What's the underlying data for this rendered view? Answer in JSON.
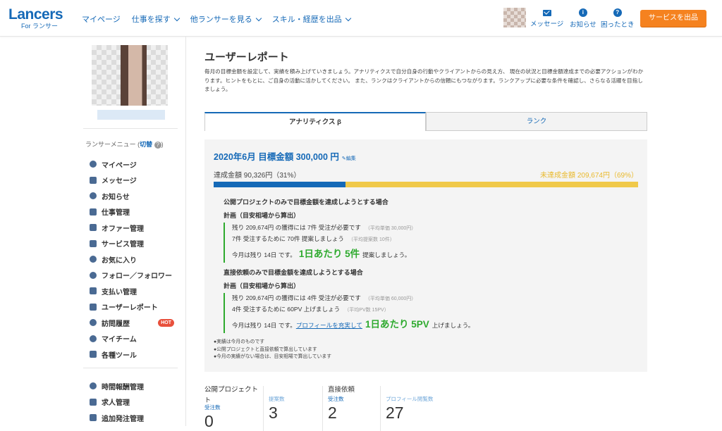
{
  "header": {
    "logo_main": "Lancers",
    "logo_sub": "For ランサー",
    "nav": [
      "マイページ",
      "仕事を探す",
      "他ランサーを見る",
      "スキル・経歴を出品"
    ],
    "messages": "メッセージ",
    "notifications": "お知らせ",
    "help": "困ったとき",
    "service_button": "サービスを出品",
    "accent": "#1569b7",
    "cta_color": "#f5821f"
  },
  "sidebar": {
    "menu_label": "ランサーメニュー (",
    "menu_switch": "切替",
    "menu_end": ")",
    "items": [
      {
        "label": "マイページ",
        "icon": "dashboard-icon"
      },
      {
        "label": "メッセージ",
        "icon": "mail-icon"
      },
      {
        "label": "お知らせ",
        "icon": "info-icon"
      },
      {
        "label": "仕事管理",
        "icon": "briefcase-icon"
      },
      {
        "label": "オファー管理",
        "icon": "briefcase-icon"
      },
      {
        "label": "サービス管理",
        "icon": "cart-icon"
      },
      {
        "label": "お気に入り",
        "icon": "star-icon"
      },
      {
        "label": "フォロー／フォロワー",
        "icon": "user-icon"
      },
      {
        "label": "支払い管理",
        "icon": "card-icon"
      },
      {
        "label": "ユーザーレポート",
        "icon": "chart-icon"
      },
      {
        "label": "訪問履歴",
        "icon": "footprint-icon",
        "badge": "HOT"
      },
      {
        "label": "マイチーム",
        "icon": "team-icon"
      },
      {
        "label": "各種ツール",
        "icon": "wrench-icon"
      }
    ],
    "items2": [
      {
        "label": "時間報酬管理",
        "icon": "clock-icon"
      },
      {
        "label": "求人管理",
        "icon": "building-icon"
      },
      {
        "label": "追加発注管理",
        "icon": "document-icon"
      }
    ]
  },
  "main": {
    "title": "ユーザーレポート",
    "intro": "毎月の目標金額を設定して、実績を積み上げていきましょう。アナリティクスで自分自身の行動やクライアントからの見え方、 現在の状況と目標金額達成までの必要アクションがわかります。ヒントをもとに、ご自身の活動に活かしてください。 また、ランクはクライアントからの信頼にもつながります。ランクアップに必要な条件を確認し、さらなる活躍を目指しましょう。",
    "tabs": [
      "アナリティクス β",
      "ランク"
    ],
    "goal_title": "2020年6月 目標金額  300,000 円",
    "edit": "編集",
    "achieved": "達成金額 90,326円（31%）",
    "remaining": "未達成金額 209,674円（69%）",
    "progress": 0.31,
    "plan1": {
      "heading": "公開プロジェクトのみで目標金額を達成しようとする場合",
      "sub": "計画（目安相場から算出）",
      "line1": "残り 209,674円 の獲得には 7件 受注が必要です",
      "line1_note": "（平均単価 30,000円）",
      "line2": "7件 受注するために 70件 提案しましょう",
      "line2_note": "（平均提案数 10件）",
      "daily_pre": "今月は残り 14日 です。",
      "daily_big": "1日あたり 5件",
      "daily_post": "提案しましょう。"
    },
    "plan2": {
      "heading": "直接依頼のみで目標金額を達成しようとする場合",
      "sub": "計画（目安相場から算出）",
      "line1": "残り 209,674円 の獲得には 4件 受注が必要です",
      "line1_note": "（平均単価 60,000円）",
      "line2": "4件 受注するために 60PV 上げましょう",
      "line2_note": "（平均PV数 15PV）",
      "daily_pre": "今月は残り 14日 です。",
      "daily_link": "プロフィールを充実して",
      "daily_big": "1日あたり 5PV",
      "daily_post": "上げましょう。"
    },
    "footnotes": [
      "●実績は今月のものです",
      "●公開プロジェクトと直接依頼で算出しています",
      "●今月の実績がない場合は、目安相場で算出しています"
    ],
    "stats": [
      {
        "heading": "公開プロジェクト",
        "heading2": "ト",
        "label": "受注数",
        "value": "0",
        "light": false
      },
      {
        "heading": "",
        "heading2": "",
        "label": "提案数",
        "value": "3",
        "light": true
      },
      {
        "heading": "直接依頼",
        "heading2": "",
        "label": "受注数",
        "value": "2",
        "light": false
      },
      {
        "heading": "",
        "heading2": "",
        "label": "プロフィール閲覧数",
        "value": "27",
        "light": true
      }
    ]
  }
}
